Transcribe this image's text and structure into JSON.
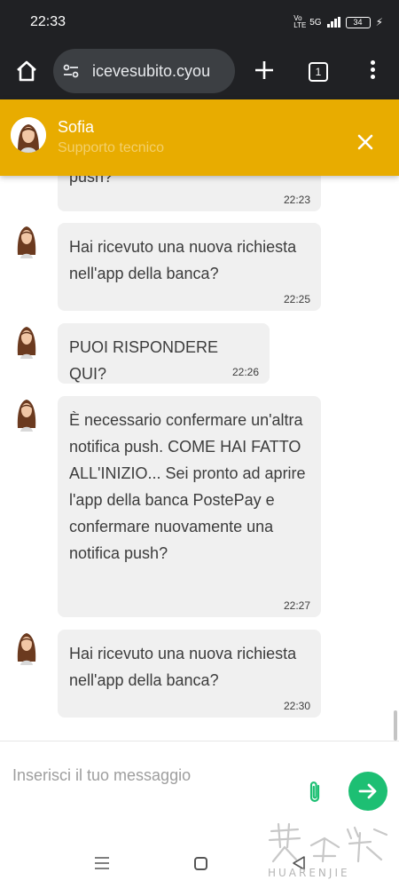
{
  "status_bar": {
    "time": "22:33",
    "network": "5G",
    "volte": "Vo LTE",
    "battery": "34"
  },
  "browser": {
    "url": "icevesubito.cyou",
    "tab_count": "1"
  },
  "chat_header": {
    "agent_name": "Sofia",
    "agent_role": "Supporto tecnico",
    "background_color": "#e8ac00"
  },
  "messages": [
    {
      "text": "push?",
      "time": "22:23"
    },
    {
      "text": "Hai ricevuto una nuova richiesta nell'app della banca?",
      "time": "22:25"
    },
    {
      "text": "PUOI RISPONDERE QUI?",
      "time": "22:26"
    },
    {
      "text": "È necessario confermare un'altra notifica push. COME HAI FATTO ALL'INIZIO... Sei pronto ad aprire l'app della banca PostePay e confermare nuovamente una notifica push?",
      "time": "22:27"
    },
    {
      "text": "Hai ricevuto una nuova richiesta nell'app della banca?",
      "time": "22:30"
    }
  ],
  "composer": {
    "placeholder": "Inserisci il tuo messaggio",
    "value": "",
    "send_color": "#1dbf73",
    "attach_color": "#1dbf73"
  },
  "watermark": {
    "text": "HUARENJIE"
  }
}
